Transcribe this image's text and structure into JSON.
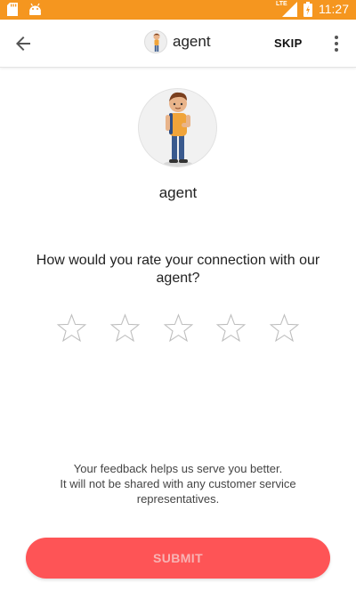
{
  "status_bar": {
    "time": "11:27",
    "left_icons": [
      "sd-card-icon",
      "android-icon"
    ],
    "right_icons": [
      "lte-signal-icon",
      "battery-icon"
    ],
    "lte_label": "LTE",
    "background": "#f5961f"
  },
  "toolbar": {
    "title": "agent",
    "skip_label": "SKIP",
    "back_icon": "arrow-left-icon",
    "more_icon": "more-vert-icon"
  },
  "agent": {
    "name": "agent"
  },
  "rating": {
    "question": "How would you rate your connection with our agent?",
    "max_stars": 5,
    "selected": 0
  },
  "feedback": {
    "line1": "Your feedback helps us serve you better.",
    "line2": "It will not be shared with any customer service",
    "line3": "representatives."
  },
  "submit": {
    "label": "SUBMIT",
    "color": "#fe5456"
  }
}
